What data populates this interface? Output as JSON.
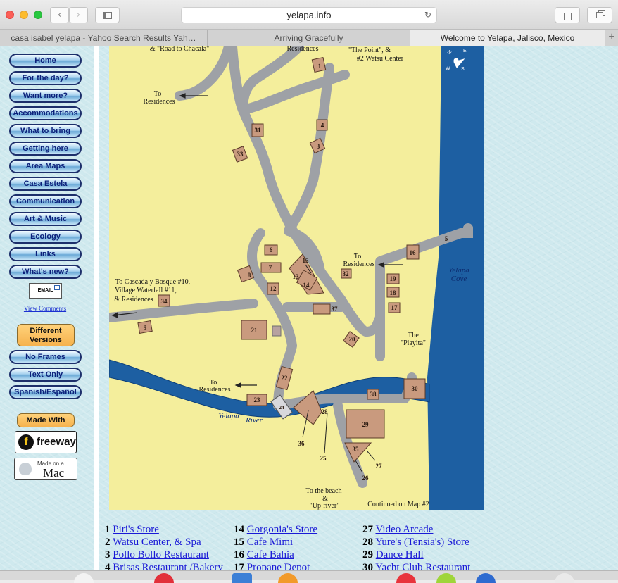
{
  "browser": {
    "url": "yelapa.info",
    "tabs": [
      {
        "label": "casa isabel yelapa - Yahoo Search Results Yah…",
        "active": false
      },
      {
        "label": "Arriving Gracefully",
        "active": false
      },
      {
        "label": "Welcome to Yelapa, Jalisco, Mexico",
        "active": true
      }
    ],
    "new_tab_label": "+"
  },
  "sidebar": {
    "items": [
      {
        "label": "Home"
      },
      {
        "label": "For the day?"
      },
      {
        "label": "Want more?"
      },
      {
        "label": "Accommodations"
      },
      {
        "label": "What to bring"
      },
      {
        "label": "Getting here"
      },
      {
        "label": "Area Maps"
      },
      {
        "label": "Casa Estela"
      },
      {
        "label": "Communication"
      },
      {
        "label": "Art & Music"
      },
      {
        "label": "Ecology"
      },
      {
        "label": "Links"
      },
      {
        "label": "What's new?"
      }
    ],
    "email_label": "EMAIL",
    "view_comments": "View Comments",
    "different_versions": "Different Versions",
    "versions": [
      {
        "label": "No Frames"
      },
      {
        "label": "Text Only"
      },
      {
        "label": "Spanish/Español"
      }
    ],
    "made_with": "Made With",
    "freeway_label": "freeway",
    "mac_small": "Made on a",
    "mac_big": "Mac"
  },
  "map": {
    "labels": {
      "road_to_chacala": "& \"Road to Chacala\"",
      "residences_top": "Residences",
      "the_point": "\"The Point\", &",
      "watsu_center": "#2 Watsu Center",
      "to_residences_1a": "To",
      "to_residences_1b": "Residences",
      "to_residences_2a": "To",
      "to_residences_2b": "Residences",
      "to_residences_3a": "To",
      "to_residences_3b": "Residences",
      "cascada_1": "To Cascada y Bosque #10,",
      "cascada_2": "Village Waterfall #11,",
      "cascada_3": "& Residences",
      "yelapa_cove_1": "Yelapa",
      "yelapa_cove_2": "Cove",
      "the_playita_1": "The",
      "the_playita_2": "\"Playita\"",
      "yelapa_river_1": "Yelapa",
      "yelapa_river_2": "River",
      "beach_1": "To the beach",
      "beach_2": "&",
      "beach_3": "\"Up-river\"",
      "continued": "Continued on Map #2"
    },
    "markers": [
      "1",
      "3",
      "4",
      "5",
      "6",
      "7",
      "8",
      "9",
      "12",
      "13",
      "14",
      "15",
      "16",
      "17",
      "18",
      "19",
      "20",
      "21",
      "22",
      "23",
      "24",
      "25",
      "26",
      "27",
      "28",
      "29",
      "30",
      "31",
      "32",
      "33",
      "34",
      "35",
      "36",
      "37",
      "38"
    ]
  },
  "legend": {
    "columns": [
      [
        {
          "num": "1",
          "name": "Piri's Store"
        },
        {
          "num": "2",
          "name": "Watsu Center, & Spa"
        },
        {
          "num": "3",
          "name": "Pollo Bollo Restaurant"
        },
        {
          "num": "4",
          "name": "Brisas Restaurant /Bakery"
        }
      ],
      [
        {
          "num": "14",
          "name": "Gorgonia's Store"
        },
        {
          "num": "15",
          "name": "Cafe Mimi"
        },
        {
          "num": "16",
          "name": "Cafe Bahia"
        },
        {
          "num": "17",
          "name": "Propane Depot"
        }
      ],
      [
        {
          "num": "27",
          "name": "Video Arcade"
        },
        {
          "num": "28",
          "name": "Yure's (Tensia's) Store"
        },
        {
          "num": "29",
          "name": "Dance Hall"
        },
        {
          "num": "30",
          "name": "Yacht Club Restaurant"
        }
      ]
    ]
  },
  "colors": {
    "map_land": "#f4ee9c",
    "road": "#9ea1a6",
    "water": "#1d5fa2",
    "building": "#c99a7e",
    "nav_text": "#0b1f7a"
  }
}
